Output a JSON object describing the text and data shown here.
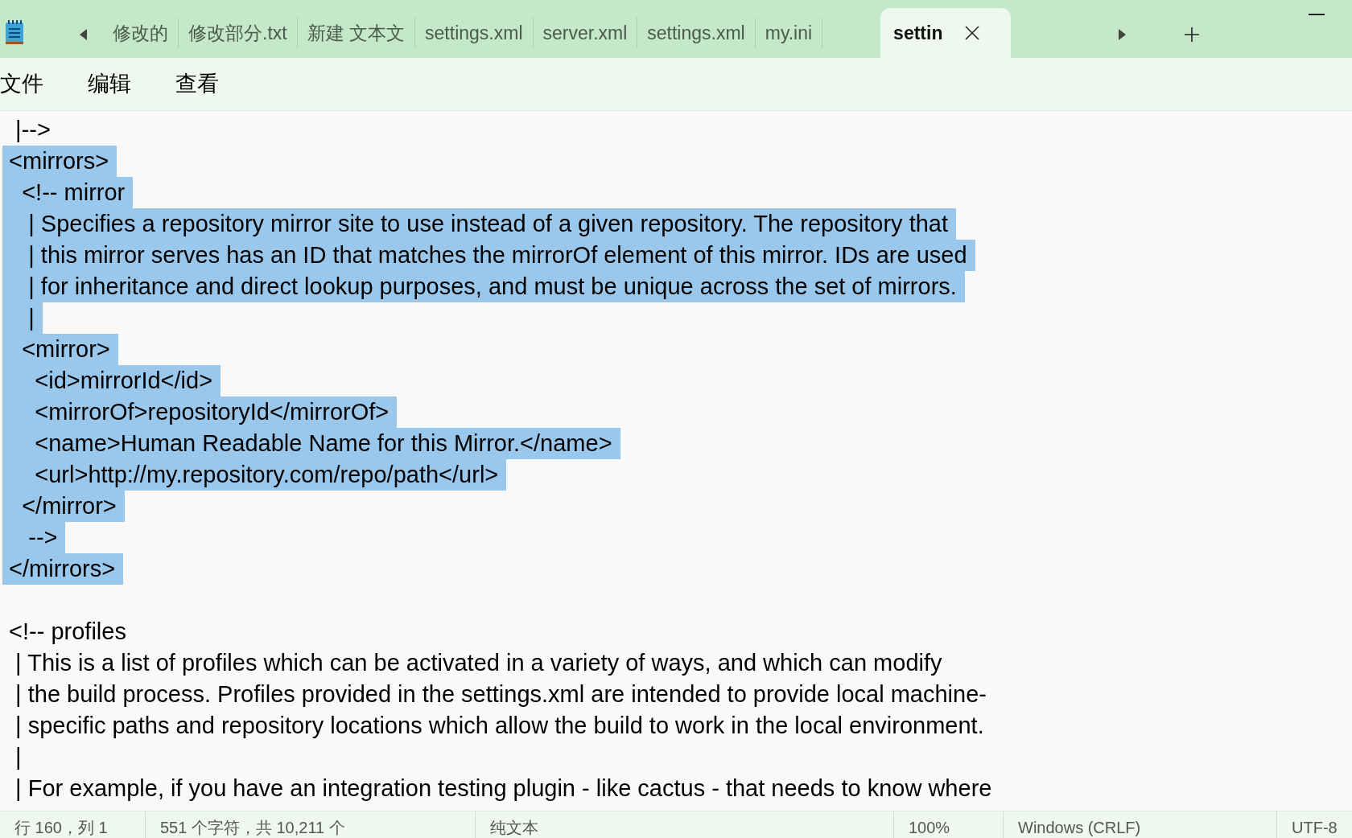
{
  "tabs": [
    {
      "label": "修改的",
      "selected": false
    },
    {
      "label": "修改部分.txt",
      "selected": false
    },
    {
      "label": "新建 文本文",
      "selected": false
    },
    {
      "label": "settings.xml",
      "selected": false
    },
    {
      "label": "server.xml",
      "selected": false
    },
    {
      "label": "settings.xml",
      "selected": false
    },
    {
      "label": "my.ini",
      "selected": false
    },
    {
      "label": "settin",
      "selected": true
    }
  ],
  "menu": [
    "文件",
    "编辑",
    "查看"
  ],
  "lines": [
    {
      "text": "  |-->",
      "selected": false
    },
    {
      "text": " <mirrors>",
      "selected": true
    },
    {
      "text": "   <!-- mirror",
      "selected": true
    },
    {
      "text": "    | Specifies a repository mirror site to use instead of a given repository. The repository that",
      "selected": true
    },
    {
      "text": "    | this mirror serves has an ID that matches the mirrorOf element of this mirror. IDs are used",
      "selected": true
    },
    {
      "text": "    | for inheritance and direct lookup purposes, and must be unique across the set of mirrors.",
      "selected": true
    },
    {
      "text": "    |",
      "selected": true
    },
    {
      "text": "   <mirror>",
      "selected": true
    },
    {
      "text": "     <id>mirrorId</id>",
      "selected": true
    },
    {
      "text": "     <mirrorOf>repositoryId</mirrorOf>",
      "selected": true
    },
    {
      "text": "     <name>Human Readable Name for this Mirror.</name>",
      "selected": true
    },
    {
      "text": "     <url>http://my.repository.com/repo/path</url>",
      "selected": true
    },
    {
      "text": "   </mirror>",
      "selected": true
    },
    {
      "text": "    -->",
      "selected": true
    },
    {
      "text": " </mirrors>",
      "selected": true
    },
    {
      "selected": false
    },
    {
      "text": " <!-- profiles",
      "selected": false
    },
    {
      "text": "  | This is a list of profiles which can be activated in a variety of ways, and which can modify",
      "selected": false
    },
    {
      "text": "  | the build process. Profiles provided in the settings.xml are intended to provide local machine-",
      "selected": false
    },
    {
      "text": "  | specific paths and repository locations which allow the build to work in the local environment.",
      "selected": false
    },
    {
      "text": "  |",
      "selected": false
    },
    {
      "text": "  | For example, if you have an integration testing plugin - like cactus - that needs to know where",
      "selected": false
    }
  ],
  "status": [
    "行 160，列 1",
    "551 个字符，共 10,211 个",
    "纯文本",
    "100%",
    "Windows (CRLF)",
    "UTF-8"
  ]
}
